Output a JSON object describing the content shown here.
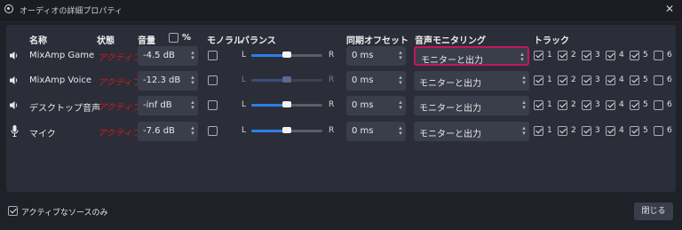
{
  "window": {
    "title": "オーディオの詳細プロパティ",
    "close_glyph": "✕"
  },
  "headers": {
    "name": "名称",
    "status": "状態",
    "volume": "音量",
    "percent": "%",
    "mono": "モノラル",
    "balance": "バランス",
    "sync_offset": "同期オフセット",
    "monitoring": "音声モニタリング",
    "tracks": "トラック"
  },
  "balance_labels": {
    "left": "L",
    "right": "R"
  },
  "track_numbers": [
    "1",
    "2",
    "3",
    "4",
    "5",
    "6"
  ],
  "rows": [
    {
      "icon": "speaker-icon",
      "name": "MixAmp Game",
      "status": "アクティブ",
      "volume": "-4.5 dB",
      "mono": false,
      "balance": 0.5,
      "balance_enabled": true,
      "sync": "0 ms",
      "monitoring": "モニターと出力",
      "monitoring_focused": true,
      "tracks": [
        true,
        true,
        true,
        true,
        true,
        false
      ]
    },
    {
      "icon": "speaker-icon",
      "name": "MixAmp Voice",
      "status": "アクティブ",
      "volume": "-12.3 dB",
      "mono": false,
      "balance": 0.5,
      "balance_enabled": false,
      "sync": "0 ms",
      "monitoring": "モニターと出力",
      "monitoring_focused": false,
      "tracks": [
        true,
        true,
        true,
        true,
        true,
        false
      ]
    },
    {
      "icon": "speaker-icon",
      "name": "デスクトップ音声",
      "status": "アクティブ",
      "volume": "-inf dB",
      "mono": false,
      "balance": 0.5,
      "balance_enabled": true,
      "sync": "0 ms",
      "monitoring": "モニターと出力",
      "monitoring_focused": false,
      "tracks": [
        true,
        true,
        true,
        true,
        true,
        false
      ]
    },
    {
      "icon": "microphone-icon",
      "name": "マイク",
      "status": "アクティブ",
      "volume": "-7.6 dB",
      "mono": false,
      "balance": 0.5,
      "balance_enabled": true,
      "sync": "0 ms",
      "monitoring": "モニターと出力",
      "monitoring_focused": false,
      "tracks": [
        true,
        true,
        true,
        true,
        true,
        false
      ]
    }
  ],
  "percent_checked": false,
  "footer": {
    "active_only_label": "アクティブなソースのみ",
    "active_only_checked": true,
    "close_button": "閉じる"
  },
  "colors": {
    "status_active": "#d11a1a",
    "focus_border": "#c2185b",
    "slider_fill": "#2d7ee8"
  }
}
